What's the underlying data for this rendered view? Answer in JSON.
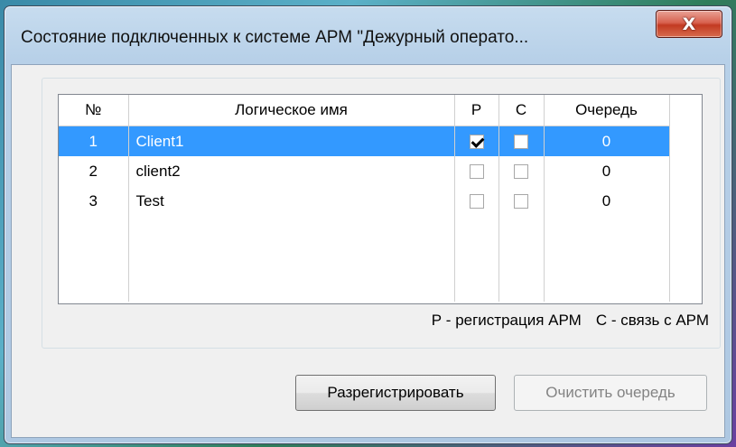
{
  "window": {
    "title": "Состояние подключенных к системе  АРМ \"Дежурный операто...",
    "close_glyph": "X"
  },
  "table": {
    "columns": [
      "№",
      "Логическое имя",
      "Р",
      "С",
      "Очередь"
    ],
    "rows": [
      {
        "num": "1",
        "name": "Client1",
        "r_checked": true,
        "c_checked": false,
        "queue": "0",
        "selected": true
      },
      {
        "num": "2",
        "name": "client2",
        "r_checked": false,
        "c_checked": false,
        "queue": "0",
        "selected": false
      },
      {
        "num": "3",
        "name": "Test",
        "r_checked": false,
        "c_checked": false,
        "queue": "0",
        "selected": false
      }
    ]
  },
  "legend": {
    "r": "Р - регистрация АРМ",
    "c": "С - связь с  АРМ"
  },
  "buttons": {
    "unregister": "Разрегистрировать",
    "clear_queue": "Очистить очередь"
  },
  "colors": {
    "selection": "#3399ff",
    "close_button": "#c23a22"
  }
}
